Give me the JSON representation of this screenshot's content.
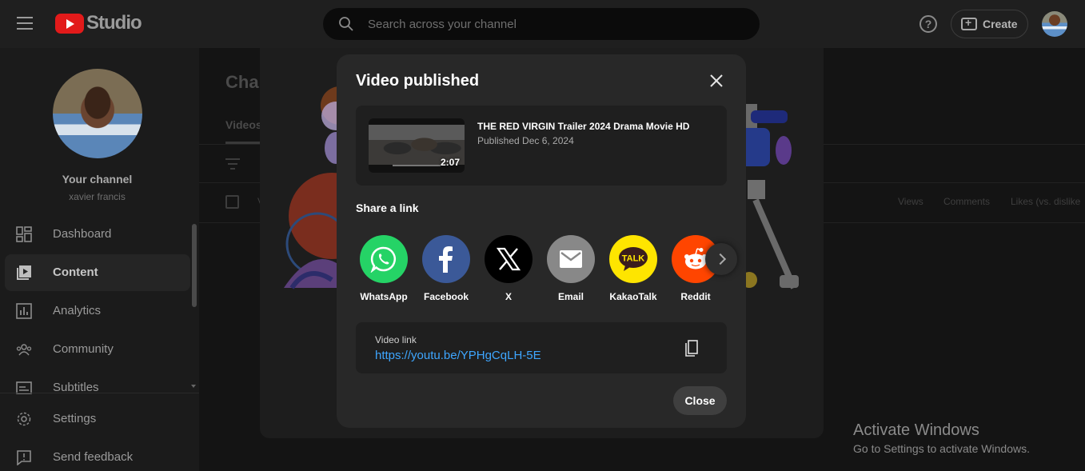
{
  "header": {
    "logo_text": "Studio",
    "search_placeholder": "Search across your channel",
    "help_glyph": "?",
    "create_label": "Create"
  },
  "sidebar": {
    "channel_title": "Your channel",
    "channel_handle": "xavier francis",
    "items": [
      {
        "label": "Dashboard",
        "icon": "dashboard-icon"
      },
      {
        "label": "Content",
        "icon": "content-icon",
        "active": true
      },
      {
        "label": "Analytics",
        "icon": "analytics-icon"
      },
      {
        "label": "Community",
        "icon": "community-icon"
      },
      {
        "label": "Subtitles",
        "icon": "subtitles-icon"
      },
      {
        "label": "Settings",
        "icon": "gear-icon"
      },
      {
        "label": "Send feedback",
        "icon": "feedback-icon"
      }
    ]
  },
  "main": {
    "page_title": "Char",
    "tab": "Videos",
    "col_partial": "V",
    "columns": [
      "Views",
      "Comments",
      "Likes (vs. dislike"
    ]
  },
  "dialog": {
    "title": "Video published",
    "video": {
      "title": "THE RED VIRGIN Trailer 2024 Drama Movie HD",
      "published": "Published Dec 6, 2024",
      "duration": "2:07"
    },
    "share_heading": "Share a link",
    "share_targets": [
      {
        "label": "WhatsApp",
        "color": "#25d366",
        "icon": "whatsapp-icon"
      },
      {
        "label": "Facebook",
        "color": "#3b5998",
        "icon": "facebook-icon"
      },
      {
        "label": "X",
        "color": "#000000",
        "icon": "x-icon"
      },
      {
        "label": "Email",
        "color": "#888888",
        "icon": "email-icon"
      },
      {
        "label": "KakaoTalk",
        "color": "#fee500",
        "icon": "kakaotalk-icon",
        "glyph": "TALK"
      },
      {
        "label": "Reddit",
        "color": "#ff4500",
        "icon": "reddit-icon"
      }
    ],
    "link_label": "Video link",
    "link_url": "https://youtu.be/YPHgCqLH-5E",
    "close_label": "Close"
  },
  "watermark": {
    "line1": "Activate Windows",
    "line2": "Go to Settings to activate Windows."
  },
  "colors": {
    "accent_link": "#3ea6ff",
    "brand_red": "#e21a1a"
  }
}
